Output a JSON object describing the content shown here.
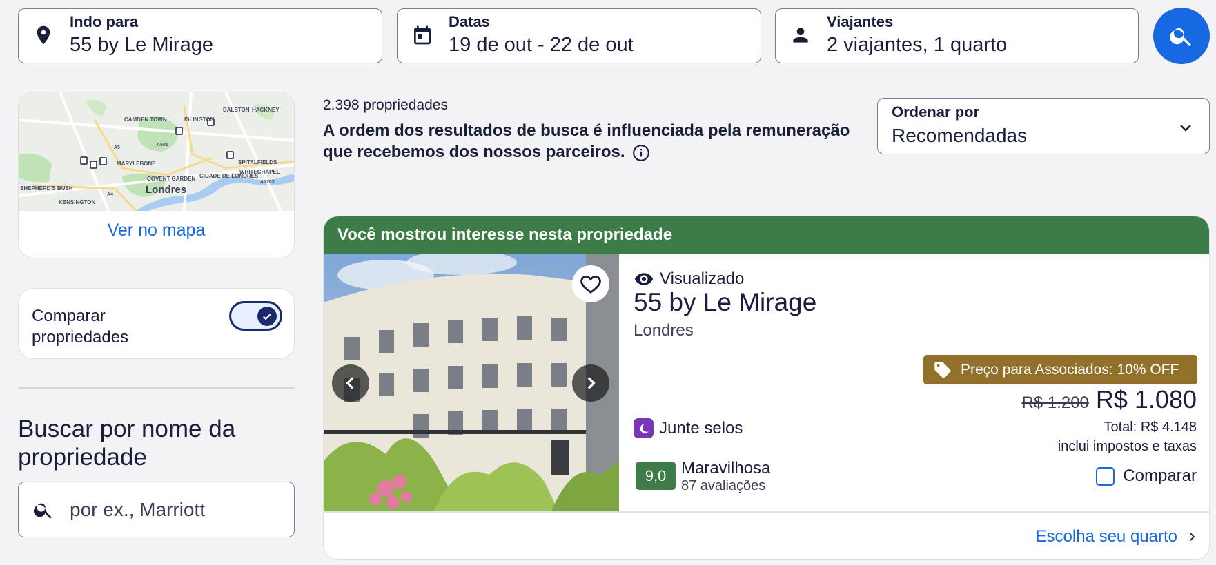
{
  "search": {
    "destination": {
      "label": "Indo para",
      "value": "55 by Le Mirage",
      "icon": "location-pin-icon"
    },
    "dates": {
      "label": "Datas",
      "value": "19 de out - 22 de out",
      "icon": "calendar-icon"
    },
    "travelers": {
      "label": "Viajantes",
      "value": "2 viajantes, 1 quarto",
      "icon": "person-icon"
    },
    "search_button_icon": "search-icon"
  },
  "sidebar": {
    "map": {
      "link_label": "Ver no mapa",
      "labels": {
        "camden": "CAMDEN TOWN",
        "islington": "ISLINGTON",
        "dalston": "DALSTON",
        "hackney": "HACKNEY",
        "marylebone": "MARYLEBONE",
        "spitalfields": "SPITALFIELDS",
        "whitechapel": "WHITECHAPEL",
        "covent_garden": "COVENT GARDEN",
        "city": "CIDADE DE LONDRES",
        "shepherds": "SHEPHERD'S BUSH",
        "kensington": "KENSINGTON",
        "city_name": "Londres",
        "road_a501": "A501",
        "road_a5": "A5",
        "road_a1203": "A1203",
        "road_a4": "A4"
      }
    },
    "compare": {
      "label": "Comparar propriedades",
      "enabled": true
    },
    "name_search": {
      "heading": "Buscar por nome da propriedade",
      "placeholder": "por ex., Marriott"
    }
  },
  "results": {
    "count": "2.398 propriedades",
    "disclaimer": "A ordem dos resultados de busca é influenciada pela remuneração que recebemos dos nossos parceiros.",
    "sort": {
      "label": "Ordenar por",
      "value": "Recomendadas"
    }
  },
  "listing": {
    "banner": "Você mostrou interesse nesta propriedade",
    "viewed": "Visualizado",
    "name": "55 by Le Mirage",
    "city": "Londres",
    "stamps": "Junte selos",
    "rating_score": "9,0",
    "rating_word": "Maravilhosa",
    "rating_count": "87 avaliações",
    "member_tag": "Preço para Associados: 10% OFF",
    "old_price": "R$ 1.200",
    "price": "R$ 1.080",
    "total": "Total: R$ 4.148",
    "taxes": "inclui impostos e taxas",
    "compare_label": "Comparar",
    "cta": "Escolha seu quarto"
  },
  "colors": {
    "accent": "#1668e3",
    "banner_green": "#3d7b48",
    "member_gold": "#91712a",
    "stamp_purple": "#7a35b8"
  }
}
